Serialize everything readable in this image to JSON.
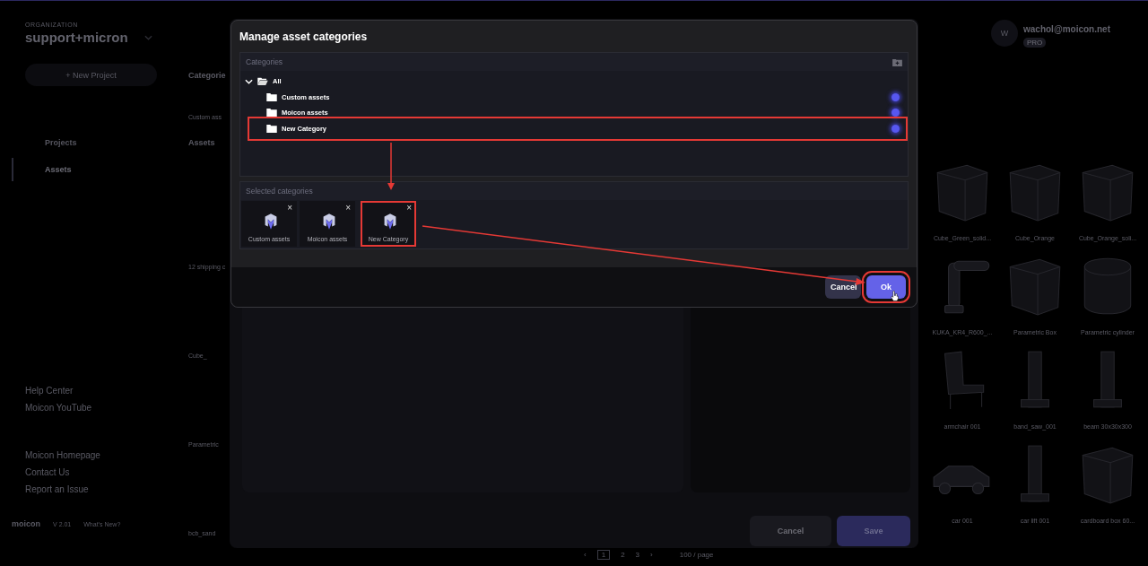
{
  "sidebar": {
    "org_label": "ORGANIZATION",
    "org_name": "support+micron",
    "new_project_icon": "+",
    "new_project": "New Project",
    "nav": [
      {
        "label": "Projects",
        "selected": false
      },
      {
        "label": "Assets",
        "selected": true
      }
    ],
    "links_a": [
      "Help Center",
      "Moicon YouTube"
    ],
    "links_b": [
      "Moicon Homepage",
      "Contact Us",
      "Report an Issue"
    ],
    "logo": "moicon",
    "version": "V 2.01",
    "whats_new": "What's New?"
  },
  "strip": {
    "categories_heading": "Categorie",
    "category": "Custom ass",
    "assets_heading": "Assets",
    "assets": [
      "12 shipping c",
      "Cube_",
      "Parametric",
      "bcb_sand"
    ]
  },
  "account": {
    "avatar": "W",
    "email": "wachol@moicon.net",
    "badge": "PRO"
  },
  "assets": [
    {
      "name": "Cube_Green_solid...",
      "kind": "cube"
    },
    {
      "name": "Cube_Orange",
      "kind": "cube"
    },
    {
      "name": "Cube_Orange_soli...",
      "kind": "cube"
    },
    {
      "name": "KUKA_KR4_R600_...",
      "kind": "arm"
    },
    {
      "name": "Parametric Box",
      "kind": "cube"
    },
    {
      "name": "Parametric cylinder",
      "kind": "cylinder"
    },
    {
      "name": "armchair 001",
      "kind": "chair"
    },
    {
      "name": "band_saw_001",
      "kind": "column"
    },
    {
      "name": "beam 30x30x300",
      "kind": "column"
    },
    {
      "name": "car 001",
      "kind": "car"
    },
    {
      "name": "car lift 001",
      "kind": "column"
    },
    {
      "name": "cardboard box 60...",
      "kind": "cube"
    }
  ],
  "pagination": {
    "prev": "‹",
    "pages": [
      {
        "label": "1",
        "selected": true
      },
      {
        "label": "2",
        "selected": false
      },
      {
        "label": "3",
        "selected": false
      }
    ],
    "next": "›",
    "page_size": "100 / page"
  },
  "edit_dialog": {
    "cancel": "Cancel",
    "save": "Save"
  },
  "modal": {
    "title": "Manage asset categories",
    "categories": {
      "header": "Categories",
      "tree": [
        {
          "label": "All",
          "expanded": true,
          "children": [
            {
              "label": "Custom assets",
              "checked": true,
              "highlighted": false
            },
            {
              "label": "Moicon assets",
              "checked": true,
              "highlighted": false
            },
            {
              "label": "New Category",
              "checked": true,
              "highlighted": true
            }
          ]
        }
      ]
    },
    "selected": {
      "header": "Selected categories",
      "items": [
        {
          "label": "Custom assets",
          "close": "×",
          "highlighted": false
        },
        {
          "label": "Moicon assets",
          "close": "×",
          "highlighted": false
        },
        {
          "label": "New Category",
          "close": "×",
          "highlighted": true
        }
      ]
    },
    "buttons": [
      {
        "label": "Cancel",
        "kind": "secondary",
        "highlighted": false
      },
      {
        "label": "Ok",
        "kind": "primary",
        "highlighted": true
      }
    ]
  }
}
